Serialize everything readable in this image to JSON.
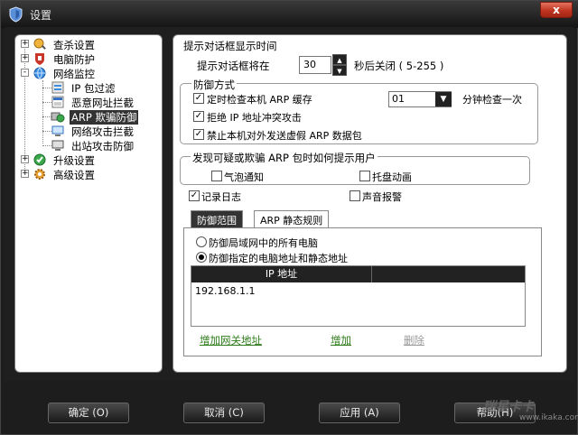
{
  "window": {
    "title": "设置",
    "close_label": "x"
  },
  "tree": {
    "items": [
      {
        "label": "查杀设置",
        "icon": "scan-settings-icon",
        "expander": "+"
      },
      {
        "label": "电脑防护",
        "icon": "computer-protection-icon",
        "expander": "+"
      },
      {
        "label": "网络监控",
        "icon": "network-monitor-icon",
        "expander": "-"
      },
      {
        "label": "IP 包过滤",
        "icon": "ip-filter-icon"
      },
      {
        "label": "恶意网址拦截",
        "icon": "malicious-url-icon"
      },
      {
        "label": "ARP 欺骗防御",
        "icon": "arp-defense-icon",
        "selected": true
      },
      {
        "label": "网络攻击拦截",
        "icon": "network-attack-icon"
      },
      {
        "label": "出站攻击防御",
        "icon": "outbound-attack-icon"
      },
      {
        "label": "升级设置",
        "icon": "upgrade-settings-icon",
        "expander": "+"
      },
      {
        "label": "高级设置",
        "icon": "advanced-settings-icon",
        "expander": "+"
      }
    ]
  },
  "dialog_time": {
    "heading": "提示对话框显示时间",
    "prefix": "提示对话框将在",
    "value": "30",
    "suffix": "秒后关闭 ( 5-255 )"
  },
  "defense": {
    "heading": "防御方式",
    "timer_check": {
      "label": "定时检查本机 ARP 缓存",
      "checked": true,
      "interval": "01",
      "interval_suffix": "分钟检查一次"
    },
    "reject_conflict": {
      "label": "拒绝 IP 地址冲突攻击",
      "checked": true
    },
    "block_fake": {
      "label": "禁止本机对外发送虚假 ARP 数据包",
      "checked": true
    }
  },
  "notify": {
    "heading": "发现可疑或欺骗 ARP 包时如何提示用户",
    "bubble": {
      "label": "气泡通知",
      "checked": false
    },
    "tray": {
      "label": "托盘动画",
      "checked": false
    }
  },
  "log": {
    "label": "记录日志",
    "checked": true
  },
  "sound": {
    "label": "声音报警",
    "checked": false
  },
  "tabs": [
    {
      "label": "防御范围",
      "active": true
    },
    {
      "label": "ARP 静态规则",
      "active": false
    }
  ],
  "scope": {
    "all": "防御局域网中的所有电脑",
    "specified": "防御指定的电脑地址和静态地址",
    "selected": "specified"
  },
  "ip_table": {
    "columns": [
      "IP 地址",
      ""
    ],
    "rows": [
      "192.168.1.1"
    ]
  },
  "links": {
    "add_gateway": "增加网关地址",
    "add": "增加",
    "delete": "删除"
  },
  "footer": {
    "ok": "确定 (O)",
    "cancel": "取消 (C)",
    "apply": "应用 (A)",
    "help": "帮助(H)"
  },
  "watermark": {
    "text": "瑞星卡卡",
    "url": "www.ikaka.com"
  },
  "colors": {
    "link_green": "#2e7d1a",
    "selected_bg": "#333333",
    "close_red": "#c0341f"
  }
}
